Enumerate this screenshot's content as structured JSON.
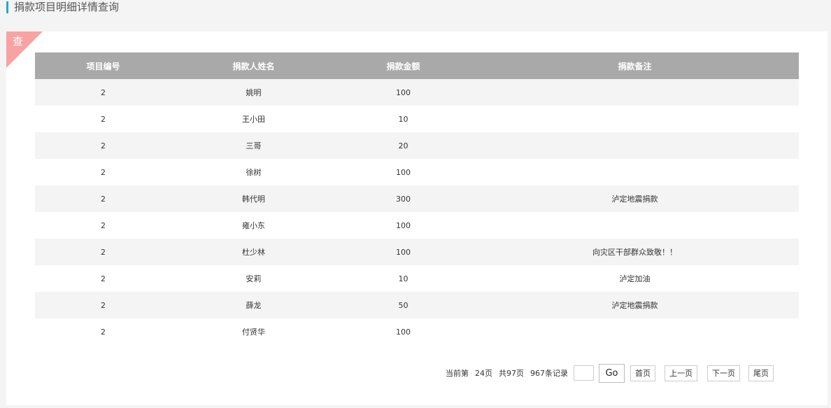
{
  "header": {
    "title": "捐款项目明细详情查询"
  },
  "panel": {
    "corner_label": "查"
  },
  "table": {
    "columns": [
      "项目编号",
      "捐款人姓名",
      "捐款金额",
      "捐款备注"
    ],
    "rows": [
      [
        "2",
        "姚明",
        "100",
        ""
      ],
      [
        "2",
        "王小田",
        "10",
        ""
      ],
      [
        "2",
        "三哥",
        "20",
        ""
      ],
      [
        "2",
        "徐树",
        "100",
        ""
      ],
      [
        "2",
        "韩代明",
        "300",
        "泸定地震捐款"
      ],
      [
        "2",
        "雍小东",
        "100",
        ""
      ],
      [
        "2",
        "杜少林",
        "100",
        "向灾区干部群众致敬！！"
      ],
      [
        "2",
        "安莉",
        "10",
        "泸定加油"
      ],
      [
        "2",
        "薛龙",
        "50",
        "泸定地震捐款"
      ],
      [
        "2",
        "付贤华",
        "100",
        ""
      ]
    ]
  },
  "pager": {
    "current_label": "当前第",
    "current_page": "24页",
    "total_pages": "共97页",
    "total_records": "967条记录",
    "page_input_value": "",
    "go_label": "Go",
    "first_label": "首页",
    "prev_label": "上一页",
    "next_label": "下一页",
    "last_label": "尾页"
  }
}
